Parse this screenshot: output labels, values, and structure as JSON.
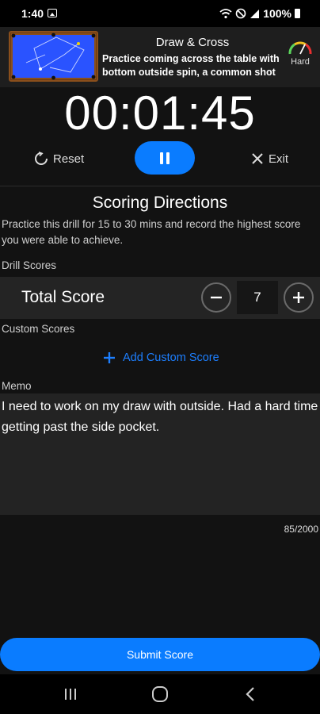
{
  "status_bar": {
    "time": "1:40",
    "battery": "100%"
  },
  "drill": {
    "title": "Draw & Cross",
    "description": "Practice coming across the table with bottom outside spin, a common shot i...",
    "difficulty": "Hard"
  },
  "timer": {
    "display": "00:01:45",
    "reset_label": "Reset",
    "exit_label": "Exit"
  },
  "scoring": {
    "title": "Scoring Directions",
    "description": "Practice this drill for 15 to 30 mins and record the highest score you were able to achieve.",
    "drill_scores_label": "Drill Scores",
    "total_score_label": "Total Score",
    "total_score_value": "7",
    "custom_scores_label": "Custom Scores",
    "add_custom_label": "Add Custom Score"
  },
  "memo": {
    "label": "Memo",
    "text": "I need to work on my draw with outside. Had a hard time getting past the side pocket.",
    "char_count": "85/2000"
  },
  "submit_label": "Submit Score",
  "colors": {
    "accent": "#0a7cff",
    "background": "#121212",
    "panel": "#242424"
  }
}
